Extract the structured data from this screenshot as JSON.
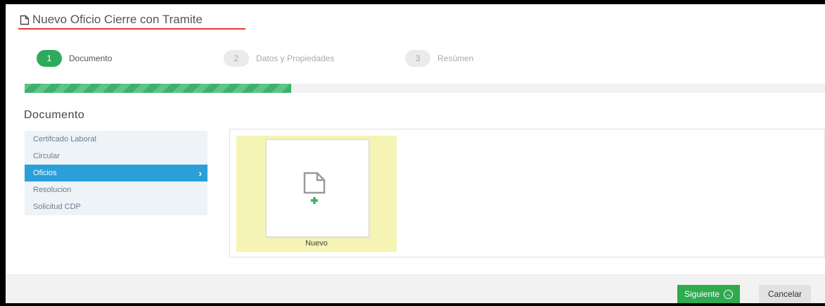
{
  "window": {
    "title": "Nuevo Oficio Cierre con Tramite"
  },
  "wizard": {
    "steps": [
      {
        "num": "1",
        "label": "Documento",
        "active": true
      },
      {
        "num": "2",
        "label": "Datos y Propiedades",
        "active": false
      },
      {
        "num": "3",
        "label": "Resúmen",
        "active": false
      }
    ],
    "progress_fraction": 0.333
  },
  "section": {
    "title": "Documento"
  },
  "doc_list": {
    "items": [
      {
        "label": "Certifcado Laboral",
        "active": false
      },
      {
        "label": "Circular",
        "active": false
      },
      {
        "label": "Oficios",
        "active": true
      },
      {
        "label": "Resolucion",
        "active": false
      },
      {
        "label": "Solicitud CDP",
        "active": false
      }
    ]
  },
  "templates": {
    "new_tile_label": "Nuevo"
  },
  "footer": {
    "next_label": "Siguiente",
    "cancel_label": "Cancelar"
  },
  "colors": {
    "accent_green": "#2eaa5c",
    "active_blue": "#2a9fd8",
    "title_underline": "#e53935",
    "tile_highlight": "#f6f4b4"
  },
  "icons": {
    "title": "document-icon",
    "tile": "new-document-icon",
    "list_active": "chevron-right-icon",
    "next": "arrow-circle-right-icon"
  }
}
